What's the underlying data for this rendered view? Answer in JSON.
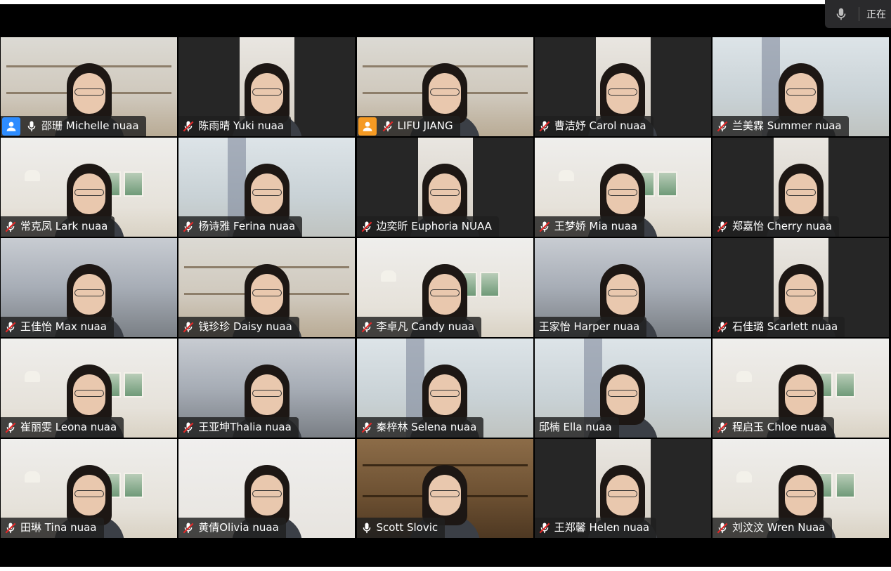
{
  "status": {
    "speaking_text": "正在",
    "mic_icon": "microphone-icon"
  },
  "colors": {
    "host_blue": "#2d8cff",
    "host_orange": "#f59a23",
    "mute_red": "#e02828"
  },
  "participants": [
    {
      "name": "邵珊 Michelle nuaa",
      "mic": "on",
      "badge": "blue",
      "bg": "bg-shelf",
      "layout": "full"
    },
    {
      "name": "陈雨晴 Yuki nuaa",
      "mic": "muted",
      "badge": "",
      "bg": "bg-dark",
      "layout": "center"
    },
    {
      "name": "LIFU JIANG",
      "mic": "muted",
      "badge": "orange",
      "bg": "bg-shelf",
      "layout": "full"
    },
    {
      "name": "曹洁妤 Carol nuaa",
      "mic": "muted",
      "badge": "",
      "bg": "bg-dark",
      "layout": "center"
    },
    {
      "name": "兰美霖 Summer nuaa",
      "mic": "muted",
      "badge": "",
      "bg": "bg-window",
      "layout": "full"
    },
    {
      "name": "常克凤 Lark nuaa",
      "mic": "muted",
      "badge": "",
      "bg": "bg-room",
      "layout": "full"
    },
    {
      "name": "杨诗雅 Ferina nuaa",
      "mic": "muted",
      "badge": "",
      "bg": "bg-window",
      "layout": "full"
    },
    {
      "name": "边奕昕 Euphoria NUAA",
      "mic": "muted",
      "badge": "",
      "bg": "bg-dark",
      "layout": "center"
    },
    {
      "name": "王梦娇 Mia nuaa",
      "mic": "muted",
      "badge": "",
      "bg": "bg-room",
      "layout": "full"
    },
    {
      "name": "郑嘉怡 Cherry nuaa",
      "mic": "muted",
      "badge": "",
      "bg": "bg-dark",
      "layout": "center"
    },
    {
      "name": "王佳怡 Max nuaa",
      "mic": "muted",
      "badge": "",
      "bg": "bg-dorm",
      "layout": "full"
    },
    {
      "name": "钱珍珍 Daisy nuaa",
      "mic": "muted",
      "badge": "",
      "bg": "bg-shelf",
      "layout": "full"
    },
    {
      "name": "李卓凡 Candy nuaa",
      "mic": "muted",
      "badge": "",
      "bg": "bg-room",
      "layout": "full"
    },
    {
      "name": "王家怡 Harper nuaa",
      "mic": "none",
      "badge": "",
      "bg": "bg-dorm",
      "layout": "full"
    },
    {
      "name": "石佳璐 Scarlett nuaa",
      "mic": "muted",
      "badge": "",
      "bg": "bg-dark",
      "layout": "center"
    },
    {
      "name": "崔丽雯 Leona nuaa",
      "mic": "muted",
      "badge": "",
      "bg": "bg-room",
      "layout": "full"
    },
    {
      "name": "王亚坤Thalia nuaa",
      "mic": "muted",
      "badge": "",
      "bg": "bg-dorm",
      "layout": "full"
    },
    {
      "name": "秦梓林 Selena nuaa",
      "mic": "muted",
      "badge": "",
      "bg": "bg-window",
      "layout": "full"
    },
    {
      "name": "邱楠 Ella nuaa",
      "mic": "none",
      "badge": "",
      "bg": "bg-window",
      "layout": "full"
    },
    {
      "name": "程启玉 Chloe nuaa",
      "mic": "muted",
      "badge": "",
      "bg": "bg-room",
      "layout": "full"
    },
    {
      "name": "田琳 Tina nuaa",
      "mic": "muted",
      "badge": "",
      "bg": "bg-room",
      "layout": "full"
    },
    {
      "name": "黄倩Olivia nuaa",
      "mic": "muted",
      "badge": "",
      "bg": "bg-plain",
      "layout": "full"
    },
    {
      "name": "Scott Slovic",
      "mic": "on",
      "badge": "",
      "bg": "bg-library",
      "layout": "full"
    },
    {
      "name": "王郑馨 Helen nuaa",
      "mic": "muted",
      "badge": "",
      "bg": "bg-dark",
      "layout": "center"
    },
    {
      "name": "刘汶汶 Wren Nuaa",
      "mic": "muted",
      "badge": "",
      "bg": "bg-room",
      "layout": "full"
    }
  ]
}
